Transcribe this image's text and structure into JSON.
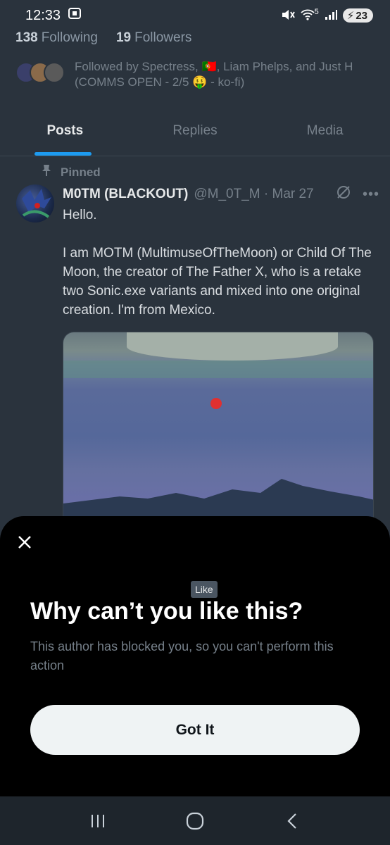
{
  "status_bar": {
    "time": "12:33",
    "wifi_superscript": "5",
    "battery": "23"
  },
  "profile": {
    "following_count": "138",
    "following_label": "Following",
    "followers_count": "19",
    "followers_label": "Followers",
    "followed_by": "Followed by Spectress, 🇵🇹, Liam Phelps, and Just H (COMMS OPEN - 2/5 🤑 - ko-fi)"
  },
  "tabs": [
    {
      "label": "Posts"
    },
    {
      "label": "Replies"
    },
    {
      "label": "Media"
    }
  ],
  "post": {
    "pinned_label": "Pinned",
    "author_name": "M0TM (BLACKOUT)",
    "author_handle": "@M_0T_M · Mar 27",
    "text_line1": "Hello.",
    "text_paragraph": "I am MOTM (MultimuseOfTheMoon) or Child Of The Moon, the creator of The Father X, who is a retake two Sonic.exe variants and mixed into one original creation. I'm from Mexico."
  },
  "sheet": {
    "tooltip": "Like",
    "title": "Why can’t you like this?",
    "description": "This author has blocked you, so you can't perform this action",
    "button": "Got It"
  },
  "colors": {
    "accent": "#1d9bf0",
    "background": "#2a333d",
    "sheet": "#000000"
  }
}
